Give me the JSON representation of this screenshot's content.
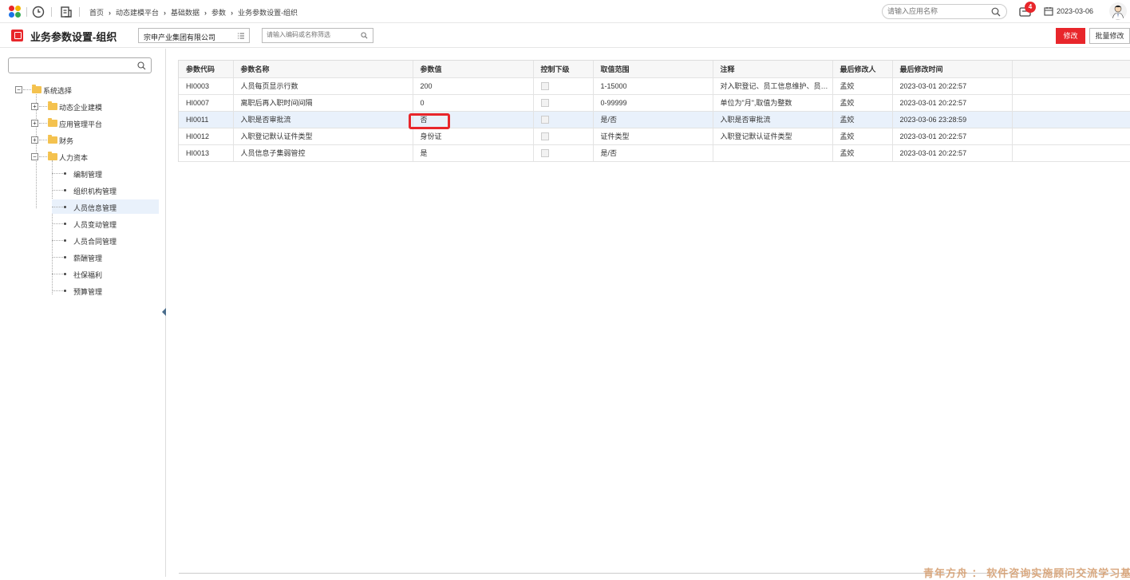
{
  "topbar": {
    "breadcrumbs": [
      "首页",
      "动态建模平台",
      "基础数据",
      "参数",
      "业务参数设置-组织"
    ],
    "app_search_placeholder": "请输入应用名称",
    "notification_count": "4",
    "date": "2023-03-06"
  },
  "titlebar": {
    "title": "业务参数设置-组织",
    "company": "宗申产业集团有限公司",
    "filter_placeholder": "请输入编码或名称筛选",
    "modify_label": "修改",
    "batch_modify_label": "批量修改"
  },
  "tree": {
    "root": "系统选择",
    "groups": [
      "动态企业建模",
      "应用管理平台",
      "财务",
      "人力资本"
    ],
    "hr_children": [
      "编制管理",
      "组织机构管理",
      "人员信息管理",
      "人员变动管理",
      "人员合同管理",
      "薪酬管理",
      "社保福利",
      "预算管理"
    ],
    "selected": "人员信息管理"
  },
  "table": {
    "columns": [
      "参数代码",
      "参数名称",
      "参数值",
      "控制下级",
      "取值范围",
      "注释",
      "最后修改人",
      "最后修改时间",
      ""
    ],
    "rows": [
      {
        "code": "HI0003",
        "name": "人员每页显示行数",
        "value": "200",
        "control": false,
        "range": "1-15000",
        "note": "对入职登记、员工信息维护、员工...",
        "modifier": "孟姣",
        "time": "2023-03-01 20:22:57"
      },
      {
        "code": "HI0007",
        "name": "离职后再入职时间间隔",
        "value": "0",
        "control": false,
        "range": "0-99999",
        "note": "单位为\"月\",取值为整数",
        "modifier": "孟姣",
        "time": "2023-03-01 20:22:57"
      },
      {
        "code": "HI0011",
        "name": "入职是否审批流",
        "value": "否",
        "control": false,
        "range": "是/否",
        "note": "入职是否审批流",
        "modifier": "孟姣",
        "time": "2023-03-06 23:28:59"
      },
      {
        "code": "HI0012",
        "name": "入职登记默认证件类型",
        "value": "身份证",
        "control": false,
        "range": "证件类型",
        "note": "入职登记默认证件类型",
        "modifier": "孟姣",
        "time": "2023-03-01 20:22:57"
      },
      {
        "code": "HI0013",
        "name": "人员信息子集弱管控",
        "value": "是",
        "control": false,
        "range": "是/否",
        "note": "",
        "modifier": "孟姣",
        "time": "2023-03-01 20:22:57"
      }
    ],
    "highlighted_row": 2
  },
  "watermark": "青年方舟 ： 软件咨询实施顾问交流学习基地。",
  "colors": {
    "accent": "#e8262b",
    "selection": "#e9f1fb",
    "folder": "#f4c24f"
  }
}
